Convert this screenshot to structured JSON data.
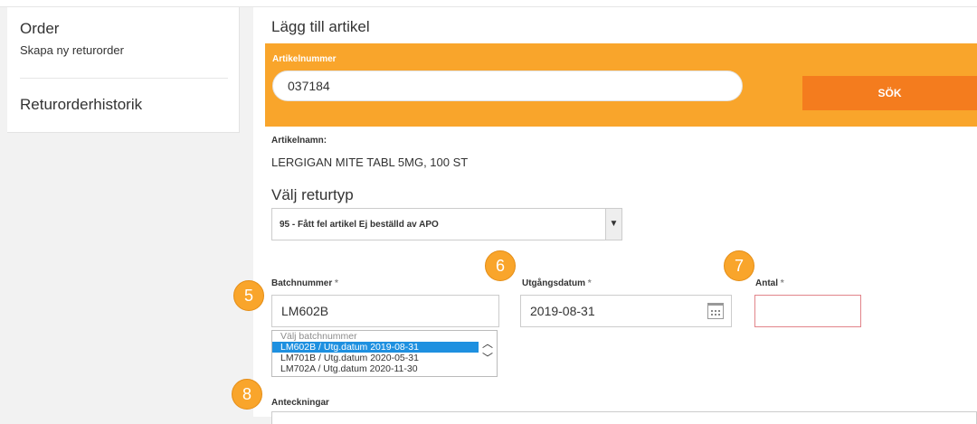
{
  "sidebar": {
    "title": "Order",
    "subtitle": "Skapa ny returorder",
    "history": "Returorderhistorik"
  },
  "main": {
    "title": "Lägg till artikel",
    "article_search": {
      "label": "Artikelnummer",
      "value": "037184",
      "button": "SÖK"
    },
    "article_name": {
      "label": "Artikelnamn:",
      "value": "LERGIGAN MITE TABL 5MG, 100 ST"
    },
    "return_type": {
      "heading": "Välj returtyp",
      "selected": "95 - Fått fel artikel Ej beställd av APO"
    },
    "batch": {
      "label": "Batchnummer",
      "value": "LM602B",
      "options": [
        "Välj batchnummer",
        "LM602B / Utg.datum 2019-08-31",
        "LM701B / Utg.datum 2020-05-31",
        "LM702A / Utg.datum 2020-11-30"
      ]
    },
    "expiry": {
      "label": "Utgångsdatum",
      "value": "2019-08-31"
    },
    "quantity": {
      "label": "Antal",
      "value": ""
    },
    "notes": {
      "label": "Anteckningar"
    },
    "required_marker": "*"
  },
  "badges": {
    "b5": "5",
    "b6": "6",
    "b7": "7",
    "b8": "8"
  },
  "colors": {
    "accent": "#f9a52b",
    "button": "#f47c1e",
    "selection": "#1e90e0",
    "error_border": "#e2848a"
  }
}
